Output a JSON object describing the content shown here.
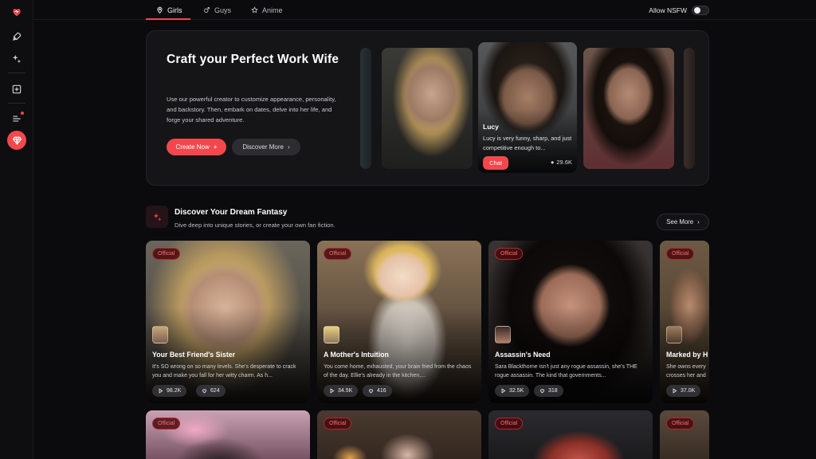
{
  "tabs": [
    {
      "label": "Girls",
      "icon": "map-pin-icon",
      "active": true
    },
    {
      "label": "Guys",
      "icon": "male-icon",
      "active": false
    },
    {
      "label": "Anime",
      "icon": "star-icon",
      "active": false
    }
  ],
  "nsfw": {
    "label": "Allow NSFW",
    "enabled": false
  },
  "hero": {
    "title": "Craft your Perfect Work Wife",
    "description": "Use our powerful creator to customize appearance, personality, and backstory. Then, embark on dates, delve into her life, and forge your shared adventure.",
    "create_label": "Create Now",
    "discover_label": "Discover More",
    "featured": {
      "name": "Lucy",
      "description": "Lucy is very funny, sharp, and just competitive enough to...",
      "chat_label": "Chat",
      "count": "29.6K"
    }
  },
  "section": {
    "title": "Discover Your Dream Fantasy",
    "subtitle": "Dive deep into unique stories, or create your own fan fiction.",
    "see_more_label": "See More"
  },
  "cards": [
    {
      "badge": "Official",
      "title": "Your Best Friend's Sister",
      "description": "It's SO wrong on so many levels. She's desperate to crack you and make you fall for her witty charm. As h...",
      "plays": "98.2K",
      "likes": "624"
    },
    {
      "badge": "Official",
      "title": "A Mother's Intuition",
      "description": "You come home, exhausted, your brain fried from the chaos of the day. Ellie's already in the kitchen,...",
      "plays": "34.5K",
      "likes": "416"
    },
    {
      "badge": "Official",
      "title": "Assassin's Need",
      "description": "Sara Blackthorne isn't just any rogue assassin, she's THE rogue assassin. The kind that governments...",
      "plays": "32.5K",
      "likes": "318"
    },
    {
      "badge": "Official",
      "title": "Marked by H",
      "description": "She owns every crosses her and",
      "plays": "37.0K",
      "likes": ""
    }
  ],
  "row2_badges": [
    "Official",
    "Official",
    "Official",
    "Official"
  ],
  "colors": {
    "accent": "#f2484d",
    "background": "#0b0b0d",
    "panel": "#151518"
  }
}
